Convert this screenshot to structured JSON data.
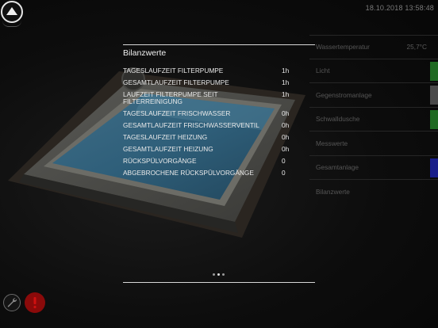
{
  "header": {
    "timestamp": "18.10.2018 13:58:48"
  },
  "panel": {
    "title": "Bilanzwerte",
    "rows": [
      {
        "label": "TAGESLAUFZEIT FILTERPUMPE",
        "value": "1h"
      },
      {
        "label": "GESAMTLAUFZEIT FILTERPUMPE",
        "value": "1h"
      },
      {
        "label": "LAUFZEIT FILTERPUMPE SEIT FILTERREINIGUNG",
        "value": "1h"
      },
      {
        "label": "TAGESLAUFZEIT FRISCHWASSER",
        "value": "0h"
      },
      {
        "label": "GESAMTLAUFZEIT FRISCHWASSERVENTIL",
        "value": "0h"
      },
      {
        "label": "TAGESLAUFZEIT HEIZUNG",
        "value": "0h"
      },
      {
        "label": "GESAMTLAUFZEIT HEIZUNG",
        "value": "0h"
      },
      {
        "label": "RÜCKSPÜLVORGÄNGE",
        "value": "0"
      },
      {
        "label": "ABGEBROCHENE RÜCKSPÜLVORGÄNGE",
        "value": "0"
      }
    ],
    "page_count": 3,
    "active_page": 2
  },
  "sidebar": {
    "items": [
      {
        "label": "Wassertemperatur",
        "value": "25,7°C",
        "indicator": ""
      },
      {
        "label": "Licht",
        "value": "",
        "indicator": "#1f6a22"
      },
      {
        "label": "Gegenstromanlage",
        "value": "",
        "indicator": "#4a4a4a"
      },
      {
        "label": "Schwalldusche",
        "value": "",
        "indicator": "#1f6a22"
      },
      {
        "label": "Messwerte",
        "value": "",
        "indicator": ""
      },
      {
        "label": "Gesamtanlage",
        "value": "",
        "indicator": "#1a1f8a"
      },
      {
        "label": "Bilanzwerte",
        "value": "",
        "indicator": ""
      }
    ]
  },
  "icons": {
    "home": "home-arrow-icon",
    "tools": "wrench-icon",
    "alert": "alert-icon"
  },
  "colors": {
    "background": "#0b0b0b",
    "alert": "#8a0a0a",
    "green": "#1f6a22",
    "blue": "#1a1f8a"
  }
}
